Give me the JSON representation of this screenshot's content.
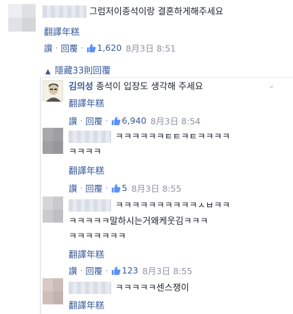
{
  "comments": [
    {
      "text": "그럼저이종석이랑 결혼하게해주세요",
      "translate": "翻譯年糕",
      "like": "讚",
      "reply": "回覆",
      "likes": "1,620",
      "time": "8月3日 8:51"
    }
  ],
  "hidden_replies": "隱藏33則回覆",
  "replies": [
    {
      "author": "김의성",
      "text": "종석이 입장도 생각해 주세요",
      "translate": "翻譯年糕",
      "like": "讚",
      "reply": "回覆",
      "likes": "6,940",
      "time": "8月3日 8:54"
    },
    {
      "text_line1": "ㅋㅋㅋㅋㅋㅋㅌㅌㅋㅌㅋㅋㅋㅋ",
      "text_line2": "ㅋㅋㅋㅋ",
      "translate": "翻譯年糕",
      "like": "讚",
      "reply": "回覆",
      "likes": "5",
      "time": "8月3日 8:55"
    },
    {
      "text_line1": "ㅋㅋㅋㅋㅋㅋㅋㅋㅋㅋㅅㅂㅋㅋ",
      "text_line2": "ㅋㅋㅋㅋㅋ말하시는거왜케웃김ㅋㅋㅋ",
      "text_line3": "ㅋㅋㅋㅋㅋㅋㅋ",
      "translate": "翻譯年糕",
      "like": "讚",
      "reply": "回覆",
      "likes": "123",
      "time": "8月3日 8:55"
    },
    {
      "text": "ㅋㅋㅋㅋㅋ센스쟁이",
      "translate": "翻譯年糕"
    }
  ],
  "colors": {
    "link": "#365899",
    "muted": "#90949c",
    "text": "#1d2129"
  },
  "icons": {
    "like": "thumbs-up-icon",
    "expand": "chevron-up-icon",
    "options": "chevron-down-icon"
  }
}
